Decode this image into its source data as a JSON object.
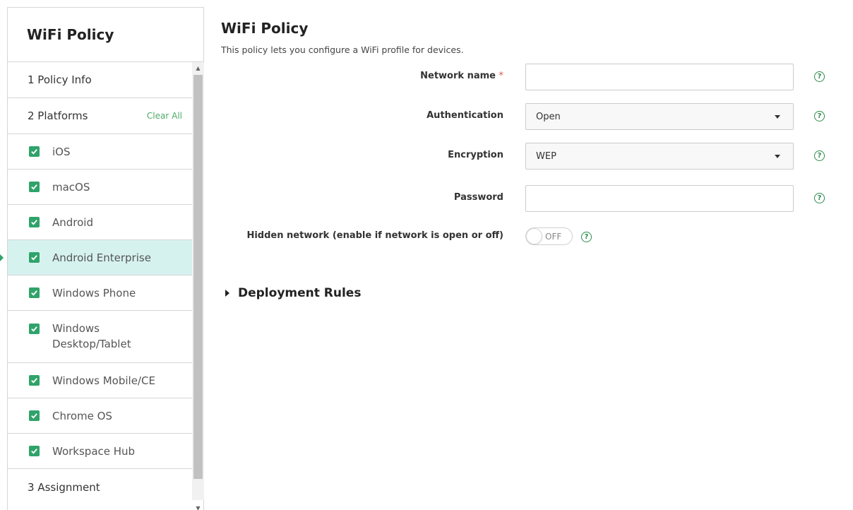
{
  "sidebar": {
    "title": "WiFi Policy",
    "steps": {
      "policy_info": "1  Policy Info",
      "platforms": "2  Platforms",
      "clear_all": "Clear All",
      "assignment": "3  Assignment"
    },
    "platforms": [
      {
        "label": "iOS",
        "checked": true
      },
      {
        "label": "macOS",
        "checked": true
      },
      {
        "label": "Android",
        "checked": true
      },
      {
        "label": "Android Enterprise",
        "checked": true,
        "active": true
      },
      {
        "label": "Windows Phone",
        "checked": true
      },
      {
        "label": "Windows Desktop/Tablet",
        "checked": true
      },
      {
        "label": "Windows Mobile/CE",
        "checked": true
      },
      {
        "label": "Chrome OS",
        "checked": true
      },
      {
        "label": "Workspace Hub",
        "checked": true
      }
    ]
  },
  "main": {
    "title": "WiFi Policy",
    "subtitle": "This policy lets you configure a WiFi profile for devices.",
    "fields": {
      "network_name": {
        "label": "Network name",
        "required_mark": "*",
        "value": ""
      },
      "authentication": {
        "label": "Authentication",
        "value": "Open"
      },
      "encryption": {
        "label": "Encryption",
        "value": "WEP"
      },
      "password": {
        "label": "Password",
        "value": ""
      },
      "hidden_network": {
        "label": "Hidden network (enable if network is open or off)",
        "state": "OFF"
      }
    },
    "deployment_rules": "Deployment Rules"
  },
  "colors": {
    "accent_green": "#2fa36a",
    "active_row_bg": "#d6f2ef",
    "required_red": "#d9534f"
  }
}
